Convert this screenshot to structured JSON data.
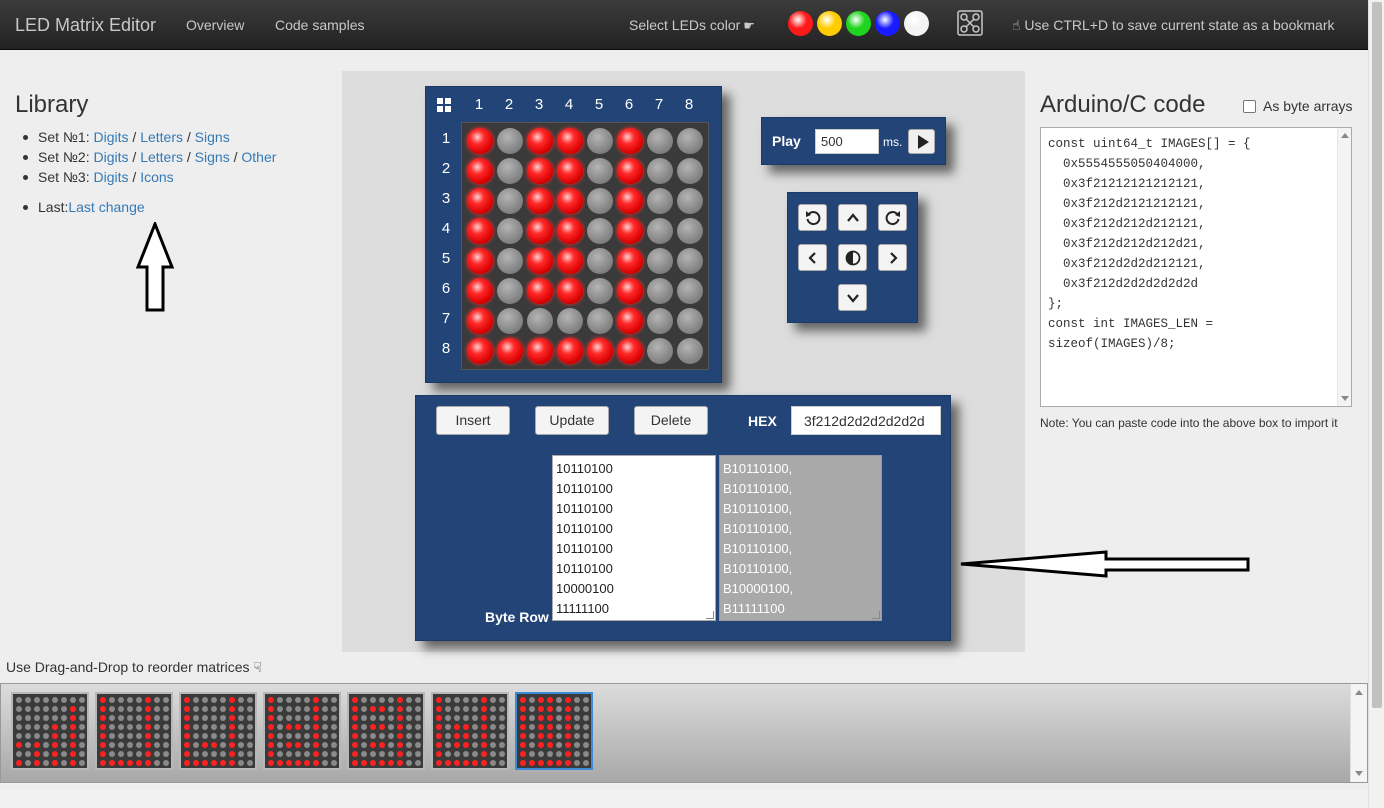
{
  "navbar": {
    "brand": "LED Matrix Editor",
    "links": [
      "Overview",
      "Code samples"
    ],
    "color_label": "Select LEDs color",
    "colors": [
      "#ff1a1a",
      "#ffcc00",
      "#1ed41e",
      "#1a1aff",
      "#f4f4f4"
    ],
    "bookmark_hint": "Use CTRL+D to save current state as a bookmark"
  },
  "library": {
    "title": "Library",
    "sets": [
      {
        "label": "Set №1: ",
        "links": [
          "Digits",
          "Letters",
          "Signs"
        ]
      },
      {
        "label": "Set №2: ",
        "links": [
          "Digits",
          "Letters",
          "Signs",
          "Other"
        ]
      },
      {
        "label": "Set №3: ",
        "links": [
          "Digits",
          "Icons"
        ]
      }
    ],
    "last_label": "Last:",
    "last_link": "Last change"
  },
  "matrix": {
    "col_headers": [
      "1",
      "2",
      "3",
      "4",
      "5",
      "6",
      "7",
      "8"
    ],
    "row_headers": [
      "1",
      "2",
      "3",
      "4",
      "5",
      "6",
      "7",
      "8"
    ],
    "rows": [
      "10110100",
      "10110100",
      "10110100",
      "10110100",
      "10110100",
      "10110100",
      "10000100",
      "11111100"
    ]
  },
  "play": {
    "label": "Play",
    "value": "500",
    "unit": "ms."
  },
  "editor": {
    "insert_label": "Insert",
    "update_label": "Update",
    "delete_label": "Delete",
    "hex_label": "HEX",
    "hex_value": "3f212d2d2d2d2d2d",
    "byte_row_label": "Byte Row",
    "binary_rows": [
      "10110100",
      "10110100",
      "10110100",
      "10110100",
      "10110100",
      "10110100",
      "10000100",
      "11111100"
    ],
    "byte_code": [
      "B10110100,",
      "B10110100,",
      "B10110100,",
      "B10110100,",
      "B10110100,",
      "B10110100,",
      "B10000100,",
      "B11111100"
    ]
  },
  "arduino": {
    "title": "Arduino/C code",
    "byte_arrays_label": "As byte arrays",
    "code_lines": [
      "const uint64_t IMAGES[] = {",
      "  0x5554555050404000,",
      "  0x3f21212121212121,",
      "  0x3f212d2121212121,",
      "  0x3f212d212d212121,",
      "  0x3f212d212d212d21,",
      "  0x3f212d2d2d212121,",
      "  0x3f212d2d2d2d2d2d",
      "};",
      "const int IMAGES_LEN =",
      "sizeof(IMAGES)/8;"
    ],
    "note": "Note: You can paste code into the above box to import it"
  },
  "thumbs": {
    "hint": "Use Drag-and-Drop to reorder matrices",
    "hexes": [
      "5554555050404000",
      "3f21212121212121",
      "3f212d2121212121",
      "3f212d212d212121",
      "3f212d212d212d21",
      "3f212d2d2d212121",
      "3f212d2d2d2d2d2d"
    ],
    "active_index": 6
  }
}
